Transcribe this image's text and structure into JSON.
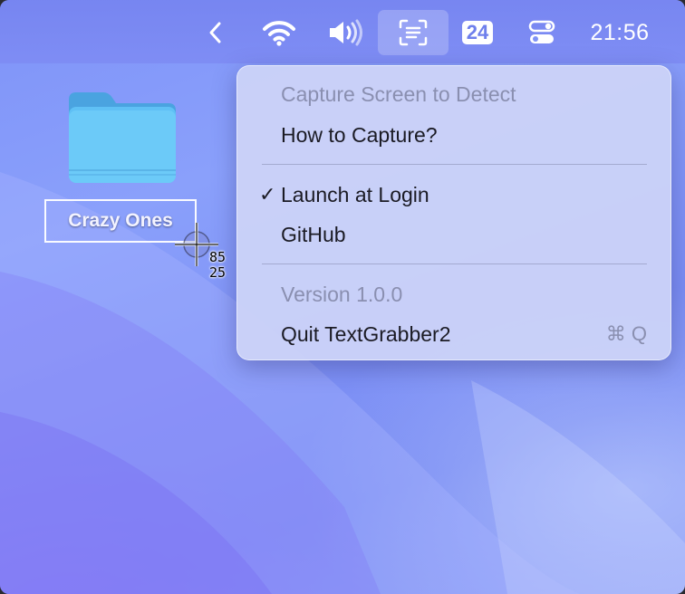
{
  "menubar": {
    "items": [
      {
        "icon": "chevron-left-icon"
      },
      {
        "icon": "wifi-icon"
      },
      {
        "icon": "speaker-volume-icon"
      },
      {
        "icon": "text-grabber-scan-icon",
        "active": true
      },
      {
        "icon": "calendar-badge-icon",
        "label": "24"
      },
      {
        "icon": "control-center-icon"
      }
    ],
    "clock": "21:56"
  },
  "desktop": {
    "folder": {
      "icon": "folder-icon",
      "label": "Crazy Ones"
    },
    "cursor": {
      "icon": "crosshair-cursor-icon",
      "coord_x": "85",
      "coord_y": "25"
    }
  },
  "menu": {
    "items": [
      {
        "label": "Capture Screen to Detect",
        "disabled": true
      },
      {
        "label": "How to Capture?",
        "disabled": false
      },
      {
        "label": "Launch at Login",
        "checked": true,
        "check_glyph": "✓"
      },
      {
        "label": "GitHub",
        "disabled": false
      },
      {
        "label": "Version 1.0.0",
        "disabled": true
      },
      {
        "label": "Quit TextGrabber2",
        "shortcut": "⌘ Q"
      }
    ]
  },
  "colors": {
    "wallpaper": "#8095f8",
    "menu_bg": "#cdd4f8",
    "menu_text": "#1b1b24",
    "menu_disabled": "#8a8fb0",
    "badge_text": "#6f80ec"
  }
}
